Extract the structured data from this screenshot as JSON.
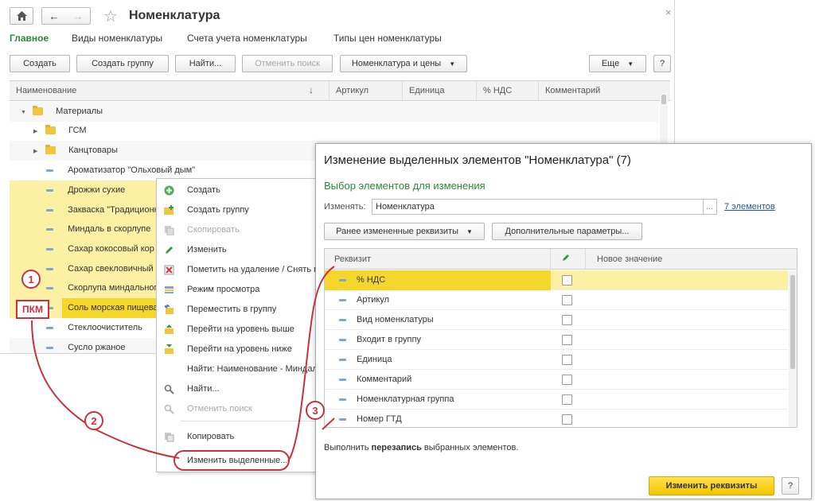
{
  "main": {
    "title": "Номенклатура",
    "home_icon": "home-icon",
    "close_glyph": "×",
    "tabs": [
      {
        "label": "Главное",
        "active": true
      },
      {
        "label": "Виды номенклатуры"
      },
      {
        "label": "Счета учета номенклатуры"
      },
      {
        "label": "Типы цен номенклатуры"
      }
    ],
    "toolbar": {
      "create": "Создать",
      "create_group": "Создать группу",
      "find": "Найти...",
      "cancel_search": "Отменить поиск",
      "nom_prices": "Номенклатура и цены",
      "more": "Еще",
      "help": "?"
    },
    "columns": {
      "name": "Наименование",
      "sort": "↓",
      "article": "Артикул",
      "unit": "Единица",
      "vat": "% НДС",
      "comment": "Комментарий"
    },
    "rows": [
      {
        "label": "Материалы",
        "kind": "folder-open"
      },
      {
        "label": "ГСМ",
        "kind": "folder"
      },
      {
        "label": "Канцтовары",
        "kind": "folder"
      },
      {
        "label": "Ароматизатор \"Ольховый дым\"",
        "kind": "item"
      },
      {
        "label": "Дрожжи сухие",
        "kind": "item"
      },
      {
        "label": "Закваска \"Традиционн",
        "kind": "item"
      },
      {
        "label": "Миндаль в скорлупе",
        "kind": "item"
      },
      {
        "label": "Сахар кокосовый кор",
        "kind": "item"
      },
      {
        "label": "Сахар свекловичный",
        "kind": "item"
      },
      {
        "label": "Скорлупа миндальног",
        "kind": "item"
      },
      {
        "label": "Соль морская пищева",
        "kind": "item"
      },
      {
        "label": "Стеклоочиститель",
        "kind": "item"
      },
      {
        "label": "Сусло ржаное",
        "kind": "item"
      }
    ]
  },
  "context_menu": [
    {
      "label": "Создать",
      "icon": "plus-icon"
    },
    {
      "label": "Создать группу",
      "icon": "folder-plus-icon"
    },
    {
      "label": "Скопировать",
      "icon": "copy-icon",
      "disabled": true
    },
    {
      "label": "Изменить",
      "icon": "pencil-icon"
    },
    {
      "label": "Пометить на удаление / Снять пометку",
      "icon": "delete-mark-icon"
    },
    {
      "label": "Режим просмотра",
      "icon": "view-mode-icon"
    },
    {
      "label": "Переместить в группу",
      "icon": "move-icon"
    },
    {
      "label": "Перейти на уровень выше",
      "icon": "level-up-icon"
    },
    {
      "label": "Перейти на уровень ниже",
      "icon": "level-down-icon"
    },
    {
      "label": "Найти: Наименование - Миндаль",
      "icon": ""
    },
    {
      "label": "Найти...",
      "icon": "search-icon"
    },
    {
      "label": "Отменить поиск",
      "icon": "cancel-search-icon",
      "disabled": true
    },
    {
      "label": "Копировать",
      "icon": "clipboard-icon"
    },
    {
      "label": "Изменить выделенные...",
      "icon": ""
    }
  ],
  "dialog": {
    "title": "Изменение выделенных элементов \"Номенклатура\" (7)",
    "subtitle": "Выбор элементов для изменения",
    "change_label": "Изменять:",
    "change_value": "Номенклатура",
    "ellipsis": "...",
    "elements_link": "7 элементов",
    "prev_button": "Ранее измененные реквизиты",
    "extra_button": "Дополнительные параметры...",
    "col_attr": "Реквизит",
    "col_value": "Новое значение",
    "attributes": [
      "% НДС",
      "Артикул",
      "Вид номенклатуры",
      "Входит в группу",
      "Единица",
      "Комментарий",
      "Номенклатурная группа",
      "Номер ГТД"
    ],
    "footer_pre": "Выполнить ",
    "footer_bold": "перезапись",
    "footer_post": " выбранных элементов.",
    "apply": "Изменить реквизиты",
    "help": "?"
  },
  "annotations": {
    "c1": "1",
    "c2": "2",
    "c3": "3",
    "pkm": "ПКМ"
  },
  "colors": {
    "accent_green": "#2a8a3c",
    "selection": "#fbf0a4",
    "current": "#f5d72c",
    "annotation_red": "#c8323c",
    "primary_button": "#f4c400"
  }
}
